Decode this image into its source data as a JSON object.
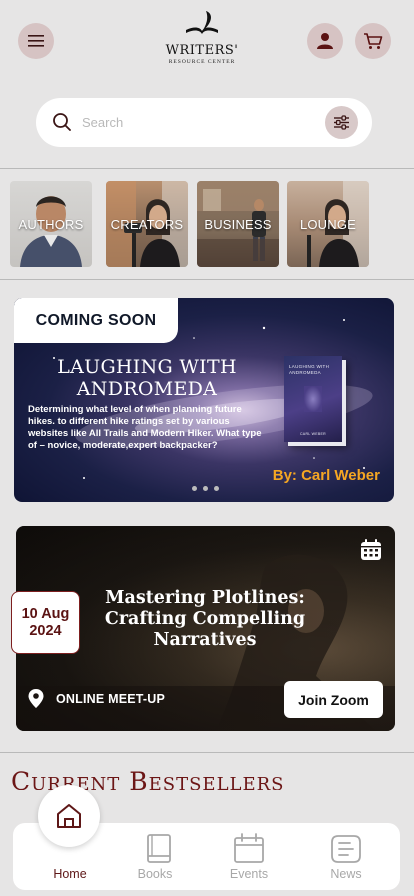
{
  "header": {
    "logo_title": "WRITERS'",
    "logo_subtitle": "RESOURCE CENTER"
  },
  "search": {
    "placeholder": "Search"
  },
  "categories": [
    {
      "label": "AUTHORS"
    },
    {
      "label": "CREATORS"
    },
    {
      "label": "BUSINESS"
    },
    {
      "label": "LOUNGE"
    }
  ],
  "promo": {
    "tag": "COMING SOON",
    "title_line1": "LAUGHING WITH",
    "title_line2": "ANDROMEDA",
    "description": "Determining what level of when planning future hikes.  to different hike ratings set by various websites like All Trails and Modern Hiker. What type of  – novice, moderate,expert backpacker?",
    "cover_title": "LAUGHING WITH ANDROMEDA",
    "cover_author": "CARL WEBER",
    "author": "By: Carl Weber",
    "slides": 3,
    "active_slide": 1
  },
  "event": {
    "date_day": "10 Aug",
    "date_year": "2024",
    "title": "Mastering Plotlines: Crafting Compelling Narratives",
    "type": "ONLINE MEET-UP",
    "button_label": "Join Zoom"
  },
  "section": {
    "bestsellers_title": "Current Bestsellers"
  },
  "nav": {
    "tabs": [
      {
        "label": "Home",
        "icon": "home-icon",
        "active": true
      },
      {
        "label": "Books",
        "icon": "book-icon",
        "active": false
      },
      {
        "label": "Events",
        "icon": "calendar-icon",
        "active": false
      },
      {
        "label": "News",
        "icon": "news-icon",
        "active": false
      }
    ]
  },
  "colors": {
    "accent": "#6c1616",
    "author_highlight": "#f5a623",
    "background": "#e6e5e5"
  }
}
